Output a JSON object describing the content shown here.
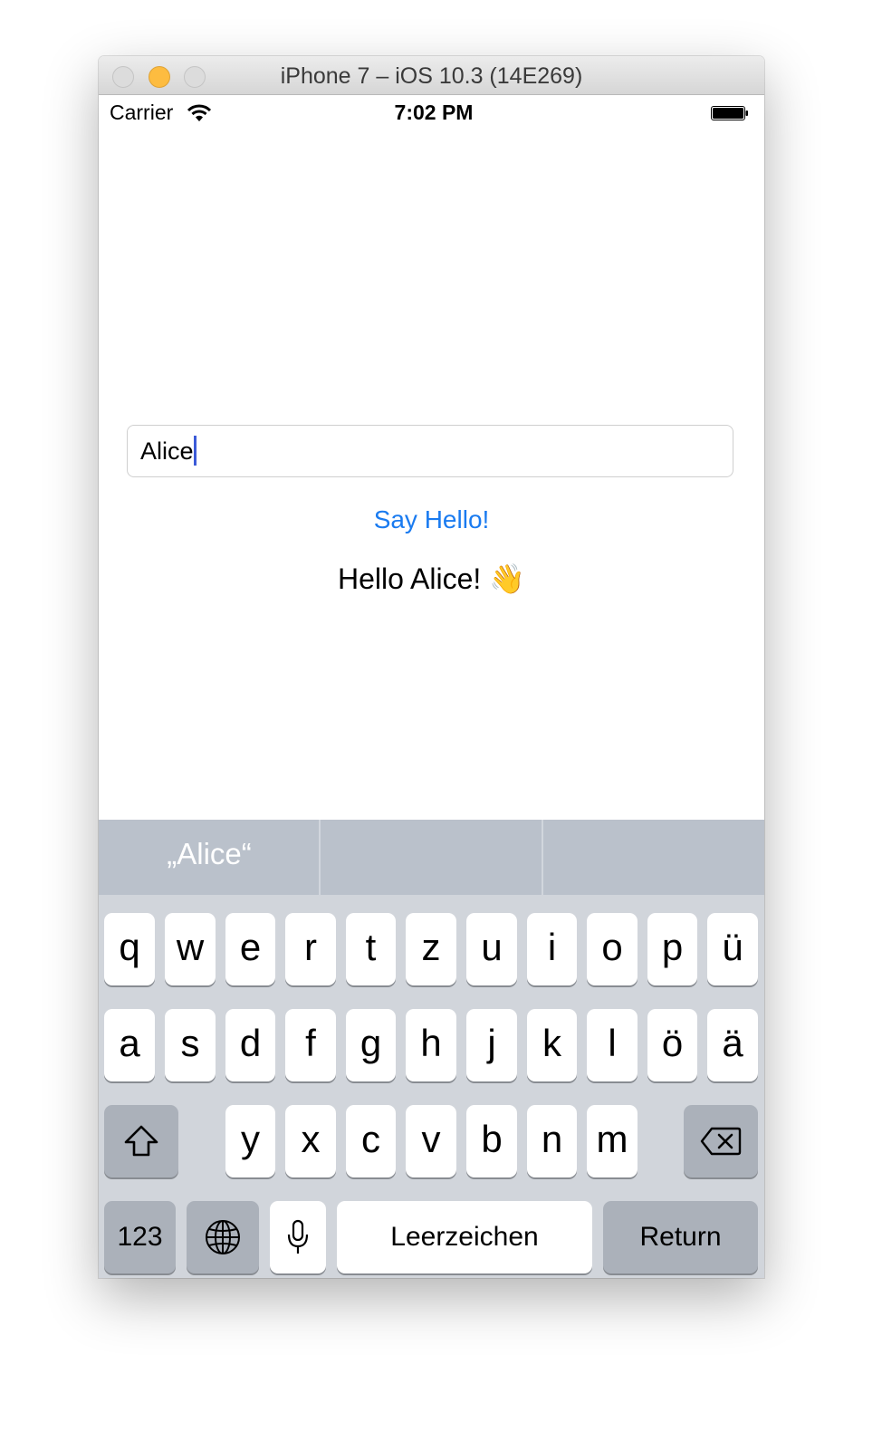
{
  "window": {
    "title": "iPhone 7 – iOS 10.3 (14E269)"
  },
  "status_bar": {
    "carrier": "Carrier",
    "time": "7:02 PM"
  },
  "app": {
    "name_field_value": "Alice",
    "say_hello_label": "Say Hello!",
    "greeting": "Hello Alice! 👋",
    "accent_color": "#1a7bf0"
  },
  "suggestions": [
    "„Alice“",
    "",
    ""
  ],
  "keyboard": {
    "row1": [
      "q",
      "w",
      "e",
      "r",
      "t",
      "z",
      "u",
      "i",
      "o",
      "p",
      "ü"
    ],
    "row2": [
      "a",
      "s",
      "d",
      "f",
      "g",
      "h",
      "j",
      "k",
      "l",
      "ö",
      "ä"
    ],
    "row3": [
      "y",
      "x",
      "c",
      "v",
      "b",
      "n",
      "m"
    ],
    "numbers_label": "123",
    "space_label": "Leerzeichen",
    "return_label": "Return",
    "shift_icon": "shift-icon",
    "delete_icon": "delete-icon",
    "globe_icon": "globe-icon",
    "mic_icon": "microphone-icon"
  }
}
